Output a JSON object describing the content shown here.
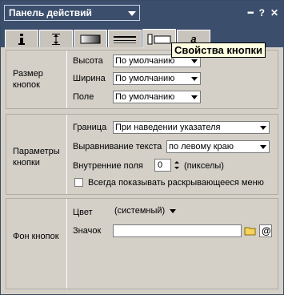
{
  "panel": {
    "title": "Панель действий",
    "more_icon": "dots-icon",
    "help_label": "?",
    "close_label": "✕"
  },
  "tooltip": "Свойства кнопки",
  "tabs": [
    {
      "icon": "info-icon"
    },
    {
      "icon": "spacing-icon"
    },
    {
      "icon": "gradient-icon"
    },
    {
      "icon": "lines-icon"
    },
    {
      "icon": "button-properties-icon",
      "active": true
    },
    {
      "icon": "text-style-icon"
    }
  ],
  "size_section": {
    "title": "Размер кнопок",
    "height_label": "Высота",
    "height_value": "По умолчанию",
    "width_label": "Ширина",
    "width_value": "По умолчанию",
    "margin_label": "Поле",
    "margin_value": "По умолчанию"
  },
  "params_section": {
    "title": "Параметры кнопки",
    "border_label": "Граница",
    "border_value": "При наведении указателя",
    "align_label": "Выравнивание текста",
    "align_value": "по левому краю",
    "padding_label": "Внутренние поля",
    "padding_value": "0",
    "padding_unit": "(пикселы)",
    "always_show_label": "Всегда показывать раскрывающееся меню",
    "always_show_checked": false
  },
  "bg_section": {
    "title": "Фон кнопок",
    "color_label": "Цвет",
    "color_value": "(системный)",
    "icon_label": "Значок",
    "icon_value": ""
  }
}
